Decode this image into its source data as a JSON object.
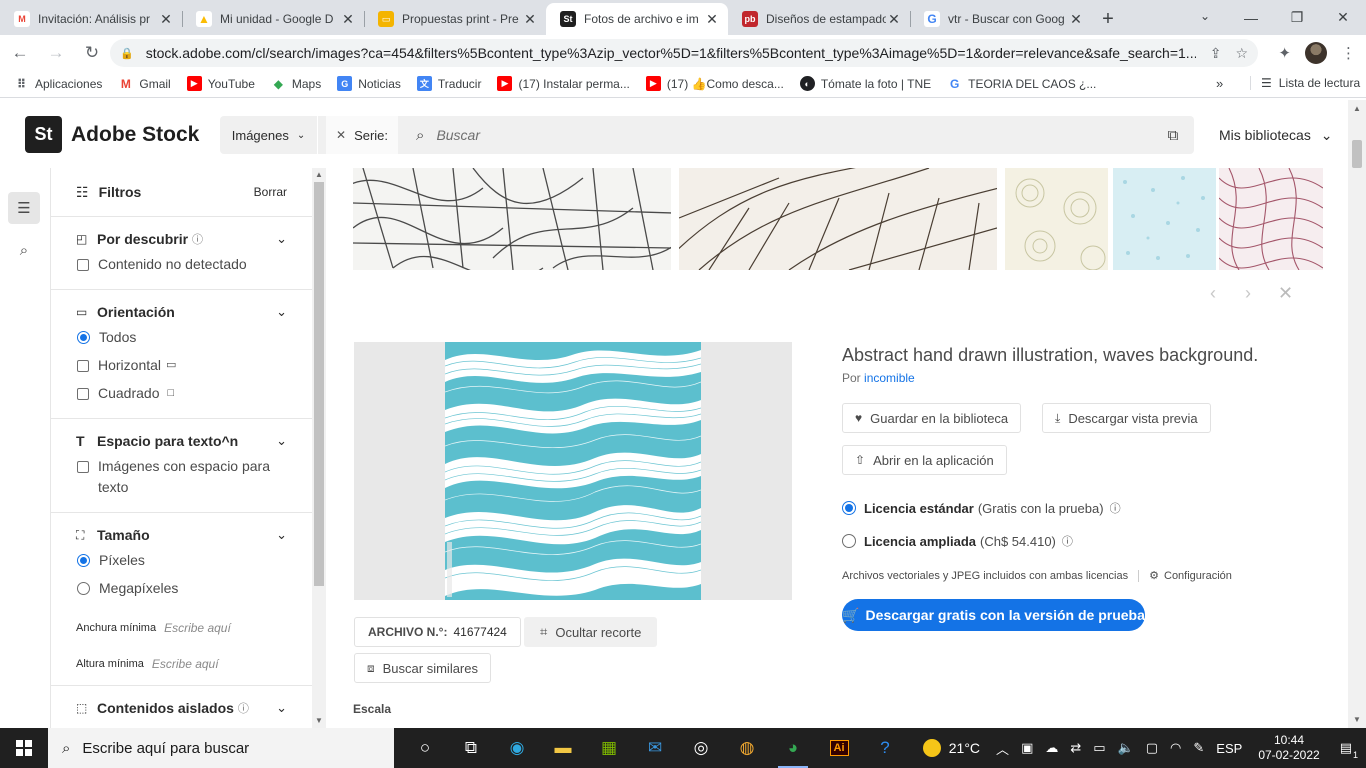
{
  "browser": {
    "tabs": [
      {
        "title": "Invitación: Análisis pr",
        "icon": "gmail-icon",
        "color": "#ea4335",
        "glyph": "M",
        "active": false
      },
      {
        "title": "Mi unidad - Google D",
        "icon": "drive-icon",
        "color": "#fbbc04",
        "glyph": "▲",
        "active": false
      },
      {
        "title": "Propuestas print - Pre",
        "icon": "slides-icon",
        "color": "#f4b400",
        "glyph": "▭",
        "active": false
      },
      {
        "title": "Fotos de archivo e im",
        "icon": "adobe-stock-icon",
        "color": "#1f1f1f",
        "glyph": "St",
        "active": true
      },
      {
        "title": "Diseños de estampado",
        "icon": "pdf-icon",
        "color": "#c1272d",
        "glyph": "pb",
        "active": false
      },
      {
        "title": "vtr - Buscar con Goog",
        "icon": "google-icon",
        "color": "#4285f4",
        "glyph": "G",
        "active": false
      }
    ],
    "new_tab": "+",
    "url": "stock.adobe.com/cl/search/images?ca=454&filters%5Bcontent_type%3Azip_vector%5D=1&filters%5Bcontent_type%3Aimage%5D=1&order=relevance&safe_search=1...",
    "bookmarks": [
      {
        "label": "Aplicaciones",
        "icon": "apps-grid-icon",
        "color": "#5f6368",
        "glyph": "⋮"
      },
      {
        "label": "Gmail",
        "icon": "gmail-icon",
        "color": "#ea4335",
        "glyph": "M"
      },
      {
        "label": "YouTube",
        "icon": "youtube-icon",
        "color": "#ff0000",
        "glyph": "▶"
      },
      {
        "label": "Maps",
        "icon": "maps-icon",
        "color": "#34a853",
        "glyph": "◆"
      },
      {
        "label": "Noticias",
        "icon": "news-icon",
        "color": "#4285f4",
        "glyph": "G"
      },
      {
        "label": "Traducir",
        "icon": "translate-icon",
        "color": "#4285f4",
        "glyph": "文"
      },
      {
        "label": "(17) Instalar perma...",
        "icon": "youtube-icon",
        "color": "#ff0000",
        "glyph": "▶"
      },
      {
        "label": "(17) 👍Como desca...",
        "icon": "youtube-icon",
        "color": "#ff0000",
        "glyph": "▶"
      },
      {
        "label": "Tómate la foto | TNE",
        "icon": "tne-icon",
        "color": "#202124",
        "glyph": "◐"
      },
      {
        "label": "TEORIA DEL CAOS ¿...",
        "icon": "google-icon",
        "color": "#4285f4",
        "glyph": "G"
      }
    ],
    "reading_list": "Lista de lectura"
  },
  "stock": {
    "logo_mark": "St",
    "logo_text": "Adobe Stock",
    "search_type": "Imágenes",
    "chip_label": "Serie:",
    "search_placeholder": "Buscar",
    "libraries": "Mis bibliotecas"
  },
  "filters": {
    "title": "Filtros",
    "clear": "Borrar",
    "discover": {
      "title": "Por descubrir",
      "option": "Contenido no detectado"
    },
    "orientation": {
      "title": "Orientación",
      "options": [
        "Todos",
        "Horizontal",
        "Cuadrado"
      ],
      "selected": "Todos"
    },
    "copy_space": {
      "title": "Espacio para texto^n",
      "option": "Imágenes con espacio para texto"
    },
    "size": {
      "title": "Tamaño",
      "options": [
        "Píxeles",
        "Megapíxeles"
      ],
      "selected": "Píxeles",
      "min_width_label": "Anchura mínima",
      "min_height_label": "Altura mínima",
      "placeholder": "Escribe aquí"
    },
    "isolated": {
      "title": "Contenidos aislados"
    }
  },
  "detail": {
    "title": "Abstract hand drawn illustration, waves background.",
    "by": "Por",
    "author": "incomible",
    "save_library": "Guardar en la biblioteca",
    "download_preview": "Descargar vista previa",
    "open_app": "Abrir en la aplicación",
    "license_standard": "Licencia estándar",
    "license_standard_note": "(Gratis con la prueba)",
    "license_extended": "Licencia ampliada",
    "license_extended_note": "(Ch$ 54.410)",
    "note": "Archivos vectoriales y JPEG incluidos con ambas licencias",
    "settings": "Configuración",
    "cta": "Descargar gratis con la versión de prueba",
    "file_label": "ARCHIVO N.°:",
    "file_number": "41677424",
    "hide_crop": "Ocultar recorte",
    "find_similar": "Buscar similares",
    "scale": "Escala",
    "accent": "#1473e6",
    "pattern_color": "#4fb8c8"
  },
  "taskbar": {
    "search_placeholder": "Escribe aquí para buscar",
    "temperature": "21°C",
    "language": "ESP",
    "time": "10:44",
    "date": "07-02-2022",
    "notifications": "1"
  }
}
